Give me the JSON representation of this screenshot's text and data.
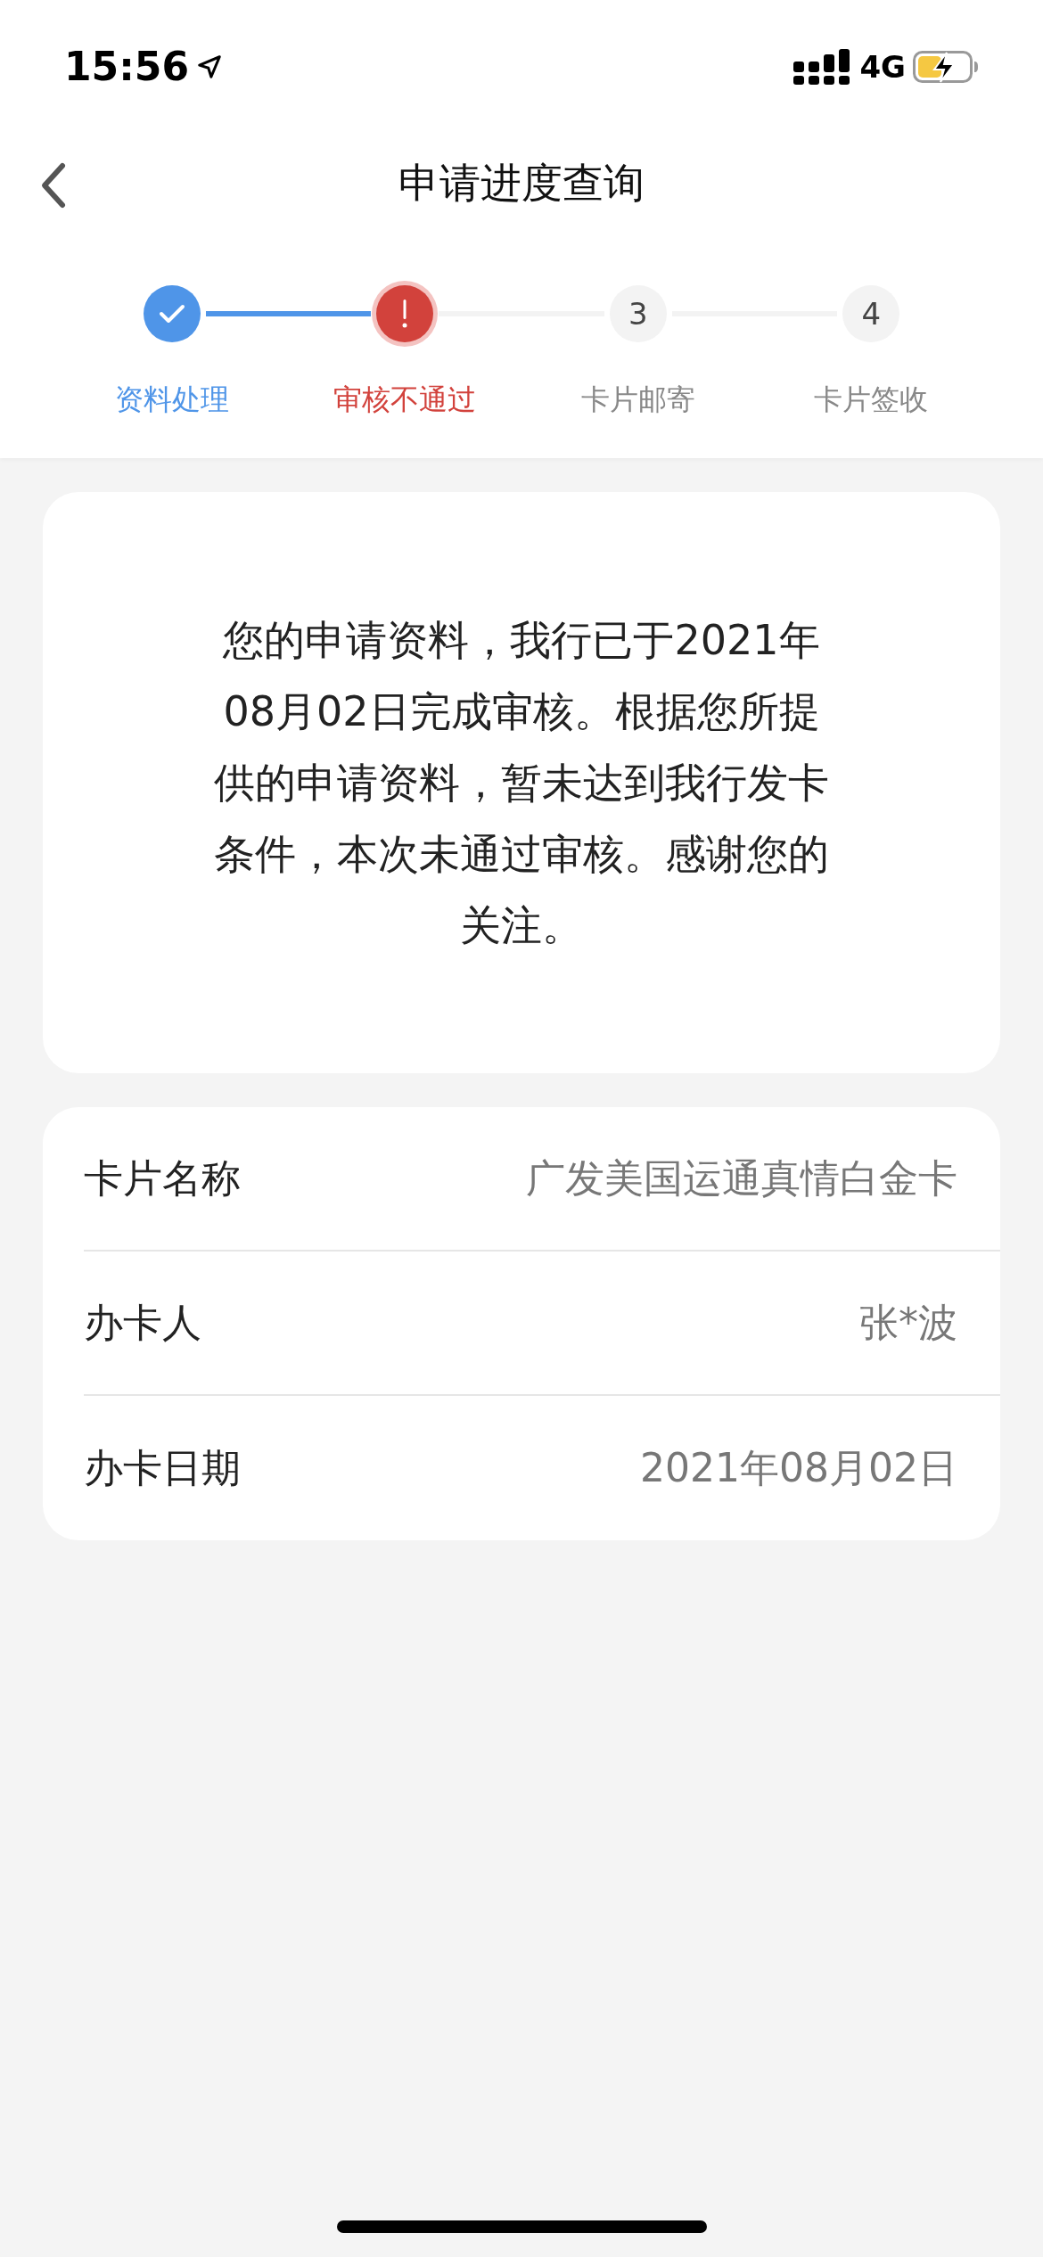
{
  "status_bar": {
    "time": "15:56",
    "network": "4G"
  },
  "nav": {
    "title": "申请进度查询"
  },
  "steps": [
    {
      "label": "资料处理",
      "kind": "done"
    },
    {
      "label": "审核不通过",
      "kind": "failed"
    },
    {
      "label": "卡片邮寄",
      "kind": "pending",
      "number": "3"
    },
    {
      "label": "卡片签收",
      "kind": "pending",
      "number": "4"
    }
  ],
  "message": "您的申请资料，我行已于2021年08月02日完成审核。根据您所提供的申请资料，暂未达到我行发卡条件，本次未通过审核。感谢您的关注。",
  "details": [
    {
      "label": "卡片名称",
      "value": "广发美国运通真情白金卡"
    },
    {
      "label": "办卡人",
      "value": "张*波"
    },
    {
      "label": "办卡日期",
      "value": "2021年08月02日"
    }
  ]
}
